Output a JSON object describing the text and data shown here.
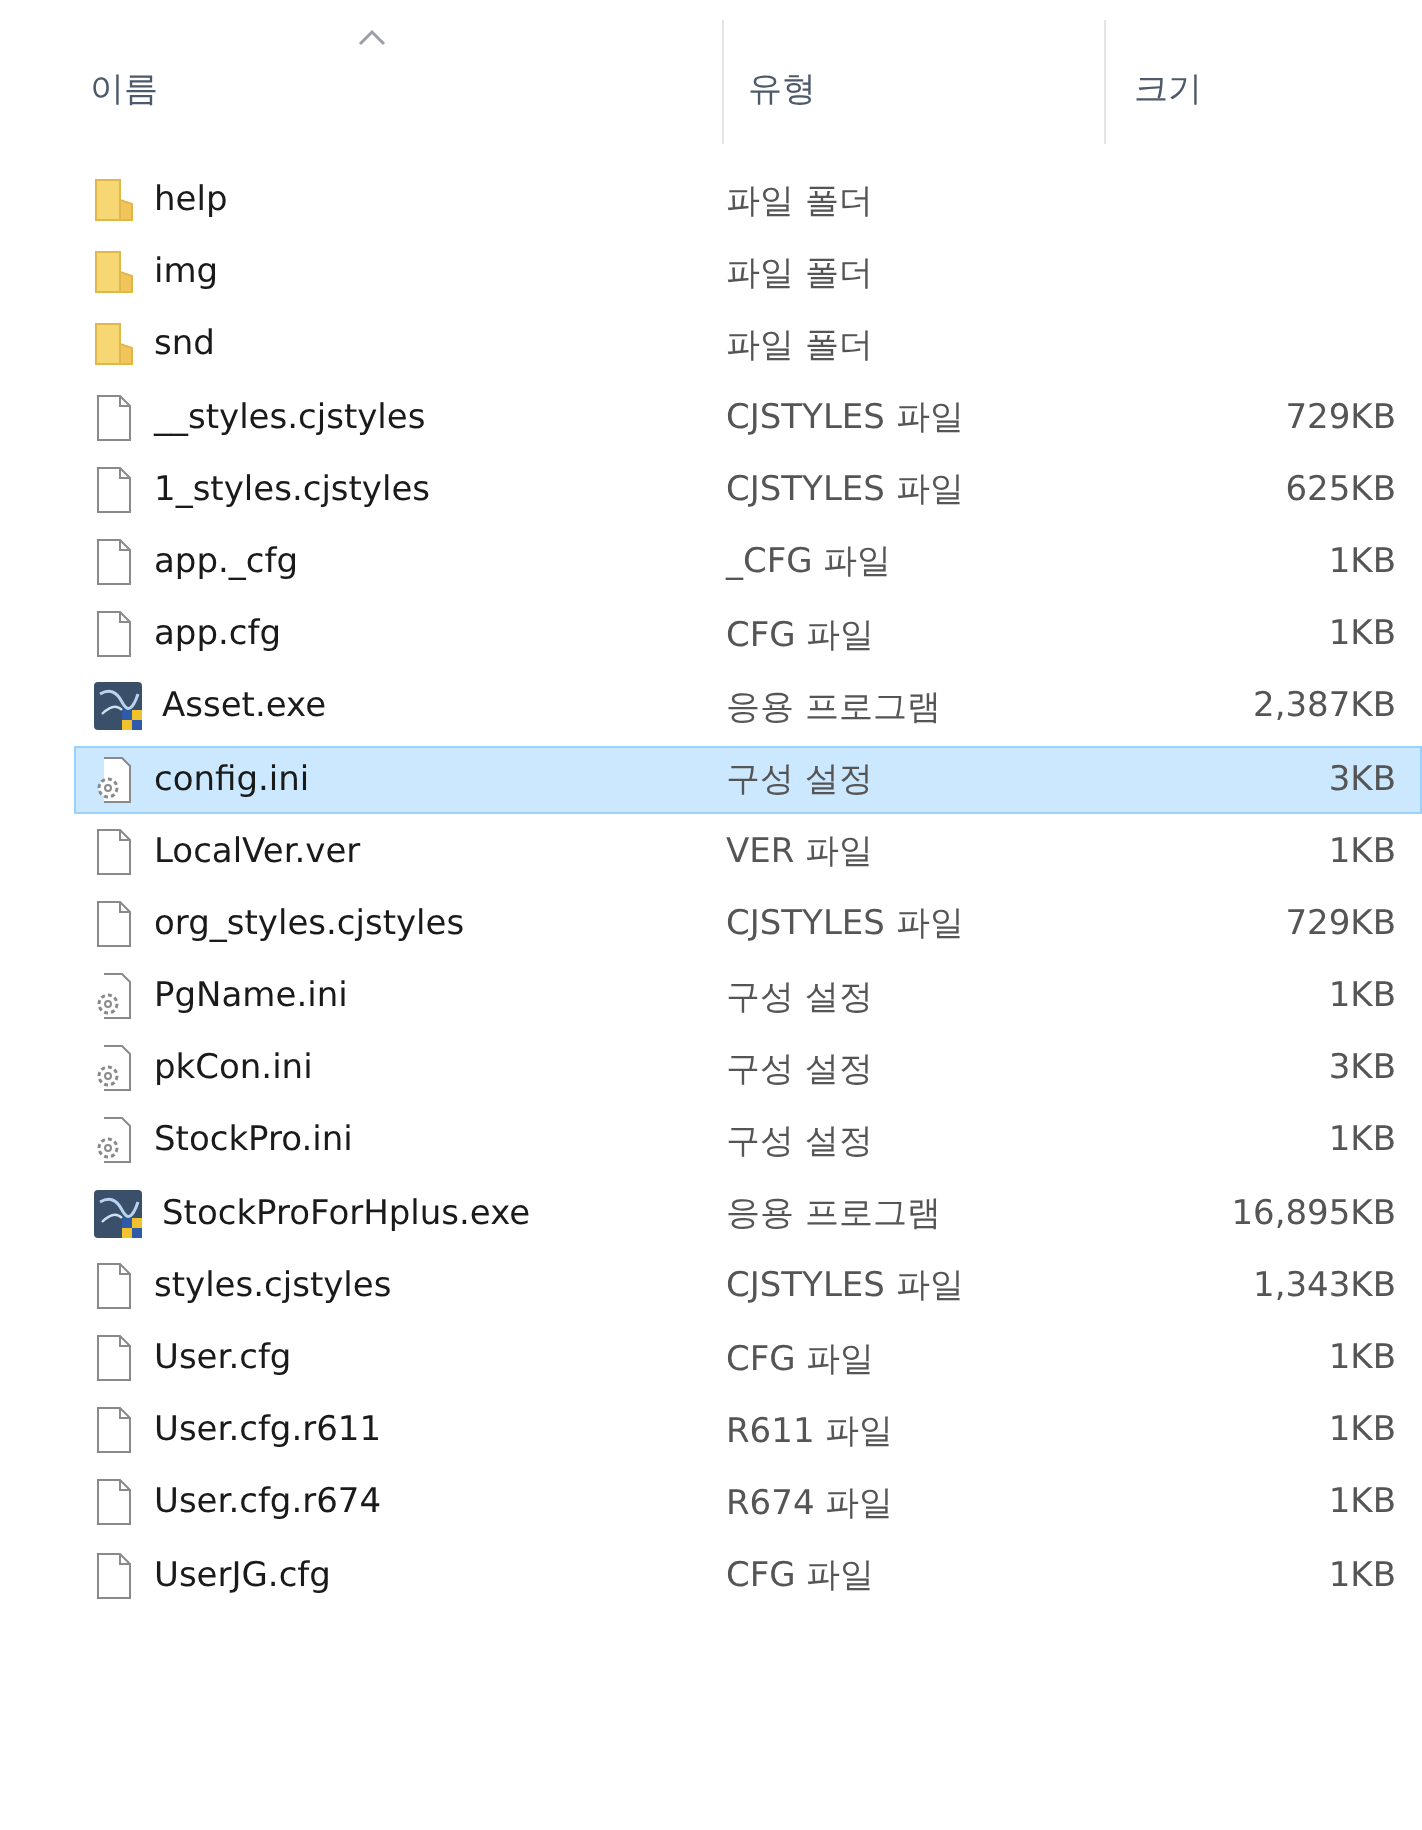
{
  "columns": [
    {
      "label": "이름",
      "sorted": true
    },
    {
      "label": "유형",
      "sorted": false
    },
    {
      "label": "크기",
      "sorted": false
    }
  ],
  "rows": [
    {
      "kind": "folder",
      "name": "help",
      "type": "파일 폴더",
      "selected": false
    },
    {
      "kind": "folder",
      "name": "img",
      "type": "파일 폴더",
      "selected": false
    },
    {
      "kind": "folder",
      "name": "snd",
      "type": "파일 폴더",
      "selected": false
    },
    {
      "kind": "file",
      "name": "__styles.cjstyles",
      "type": "CJSTYLES 파일",
      "size": "729KB",
      "selected": false
    },
    {
      "kind": "file",
      "name": "1_styles.cjstyles",
      "type": "CJSTYLES 파일",
      "size": "625KB",
      "selected": false
    },
    {
      "kind": "file",
      "name": "app._cfg",
      "type": "_CFG 파일",
      "size": "1KB",
      "selected": false
    },
    {
      "kind": "file",
      "name": "app.cfg",
      "type": "CFG 파일",
      "size": "1KB",
      "selected": false
    },
    {
      "kind": "exe",
      "name": "Asset.exe",
      "type": "응용 프로그램",
      "size": "2,387KB",
      "selected": false
    },
    {
      "kind": "ini",
      "name": "config.ini",
      "type": "구성 설정",
      "size": "3KB",
      "selected": true
    },
    {
      "kind": "file",
      "name": "LocalVer.ver",
      "type": "VER 파일",
      "size": "1KB",
      "selected": false
    },
    {
      "kind": "file",
      "name": "org_styles.cjstyles",
      "type": "CJSTYLES 파일",
      "size": "729KB",
      "selected": false
    },
    {
      "kind": "ini",
      "name": "PgName.ini",
      "type": "구성 설정",
      "size": "1KB",
      "selected": false
    },
    {
      "kind": "ini",
      "name": "pkCon.ini",
      "type": "구성 설정",
      "size": "3KB",
      "selected": false
    },
    {
      "kind": "ini",
      "name": "StockPro.ini",
      "type": "구성 설정",
      "size": "1KB",
      "selected": false
    },
    {
      "kind": "exe",
      "name": "StockProForHplus.exe",
      "type": "응용 프로그램",
      "size": "16,895KB",
      "selected": false
    },
    {
      "kind": "file",
      "name": "styles.cjstyles",
      "type": "CJSTYLES 파일",
      "size": "1,343KB",
      "selected": false
    },
    {
      "kind": "file",
      "name": "User.cfg",
      "type": "CFG 파일",
      "size": "1KB",
      "selected": false
    },
    {
      "kind": "file",
      "name": "User.cfg.r611",
      "type": "R611 파일",
      "size": "1KB",
      "selected": false
    },
    {
      "kind": "file",
      "name": "User.cfg.r674",
      "type": "R674 파일",
      "size": "1KB",
      "selected": false
    },
    {
      "kind": "file",
      "name": "UserJG.cfg",
      "type": "CFG 파일",
      "size": "1KB",
      "selected": false
    }
  ]
}
